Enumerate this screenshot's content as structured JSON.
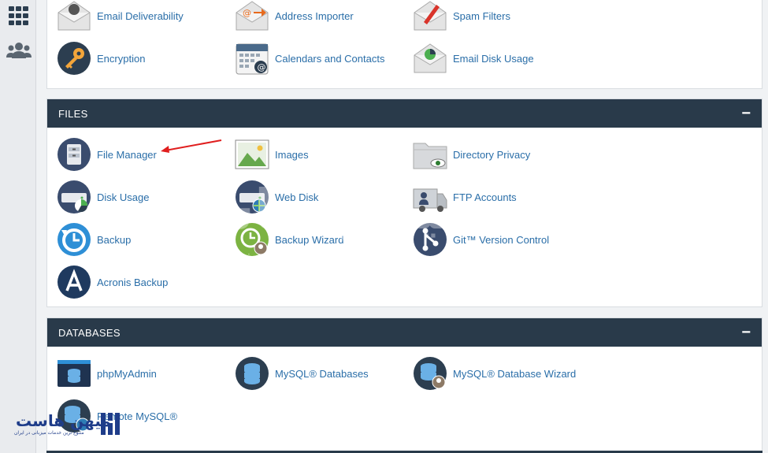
{
  "sidebar": {
    "items": [
      {
        "icon": "apps-grid-icon"
      },
      {
        "icon": "users-icon"
      }
    ]
  },
  "email_section": {
    "items": [
      {
        "label": "Email Deliverability",
        "icon": "email-deliverability-icon"
      },
      {
        "label": "Address Importer",
        "icon": "address-importer-icon"
      },
      {
        "label": "Spam Filters",
        "icon": "spam-filters-icon"
      },
      {
        "label": "Encryption",
        "icon": "encryption-key-icon"
      },
      {
        "label": "Calendars and Contacts",
        "icon": "calendar-contacts-icon"
      },
      {
        "label": "Email Disk Usage",
        "icon": "email-disk-usage-icon"
      }
    ]
  },
  "files_section": {
    "title": "FILES",
    "collapse_symbol": "−",
    "items": [
      {
        "label": "File Manager",
        "icon": "file-manager-icon"
      },
      {
        "label": "Images",
        "icon": "images-icon"
      },
      {
        "label": "Directory Privacy",
        "icon": "directory-privacy-icon"
      },
      {
        "label": "Disk Usage",
        "icon": "disk-usage-icon"
      },
      {
        "label": "Web Disk",
        "icon": "web-disk-icon"
      },
      {
        "label": "FTP Accounts",
        "icon": "ftp-accounts-icon"
      },
      {
        "label": "Backup",
        "icon": "backup-icon"
      },
      {
        "label": "Backup Wizard",
        "icon": "backup-wizard-icon"
      },
      {
        "label": "Git™ Version Control",
        "icon": "git-version-control-icon"
      },
      {
        "label": "Acronis Backup",
        "icon": "acronis-backup-icon"
      }
    ]
  },
  "databases_section": {
    "title": "DATABASES",
    "collapse_symbol": "−",
    "items": [
      {
        "label": "phpMyAdmin",
        "icon": "phpmyadmin-icon"
      },
      {
        "label": "MySQL® Databases",
        "icon": "mysql-databases-icon"
      },
      {
        "label": "MySQL® Database Wizard",
        "icon": "mysql-database-wizard-icon"
      },
      {
        "label": "Remote MySQL®",
        "icon": "remote-mysql-icon"
      }
    ]
  },
  "watermark": {
    "main": "میهن هاست",
    "sub": "متنوع ترین خدمات میزبانی در ایران"
  },
  "brand": {
    "main": "میهن هاست",
    "sub": "متنوع ترین خدمات میزبانی در ایران"
  },
  "colors": {
    "header_bg": "#293a4a",
    "link": "#2a6ea8",
    "annotation_arrow": "#e01e1e"
  }
}
